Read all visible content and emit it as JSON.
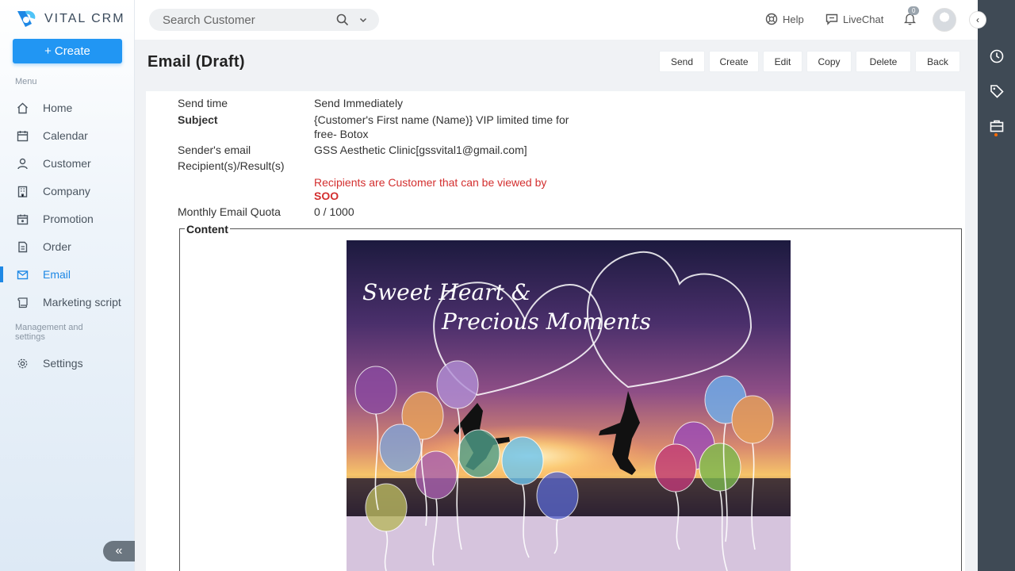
{
  "brand": {
    "name": "VITAL CRM",
    "accent": "#2196f3"
  },
  "sidebar": {
    "create_label": "Create",
    "menu_label": "Menu",
    "items": [
      {
        "label": "Home",
        "icon": "home-icon"
      },
      {
        "label": "Calendar",
        "icon": "calendar-icon"
      },
      {
        "label": "Customer",
        "icon": "user-icon"
      },
      {
        "label": "Company",
        "icon": "building-icon"
      },
      {
        "label": "Promotion",
        "icon": "promotion-icon"
      },
      {
        "label": "Order",
        "icon": "order-icon"
      },
      {
        "label": "Email",
        "icon": "mail-icon",
        "active": true
      },
      {
        "label": "Marketing script",
        "icon": "script-icon"
      }
    ],
    "management_label": "Management and settings",
    "settings_label": "Settings"
  },
  "topbar": {
    "search_placeholder": "Search Customer",
    "help_label": "Help",
    "livechat_label": "LiveChat",
    "notification_count": "0"
  },
  "page": {
    "title": "Email (Draft)",
    "actions": [
      "Send",
      "Create",
      "Edit",
      "Copy",
      "Delete",
      "Back"
    ]
  },
  "details": {
    "send_time_label": "Send time",
    "send_time_value": "Send Immediately",
    "subject_label": "Subject",
    "subject_value": "{Customer's First name (Name)} VIP limited time for free- Botox",
    "sender_label": "Sender's email",
    "sender_value": "GSS Aesthetic Clinic[gssvital1@gmail.com]",
    "recipients_label": "Recipient(s)/Result(s)",
    "recipients_note": "Recipients are Customer that can be viewed by",
    "recipients_owner": "SOO",
    "quota_label": "Monthly Email Quota",
    "quota_value": "0 / 1000",
    "content_label": "Content"
  },
  "email_image": {
    "text_line1": "Sweet Heart &",
    "text_line2": "Precious Moments"
  }
}
